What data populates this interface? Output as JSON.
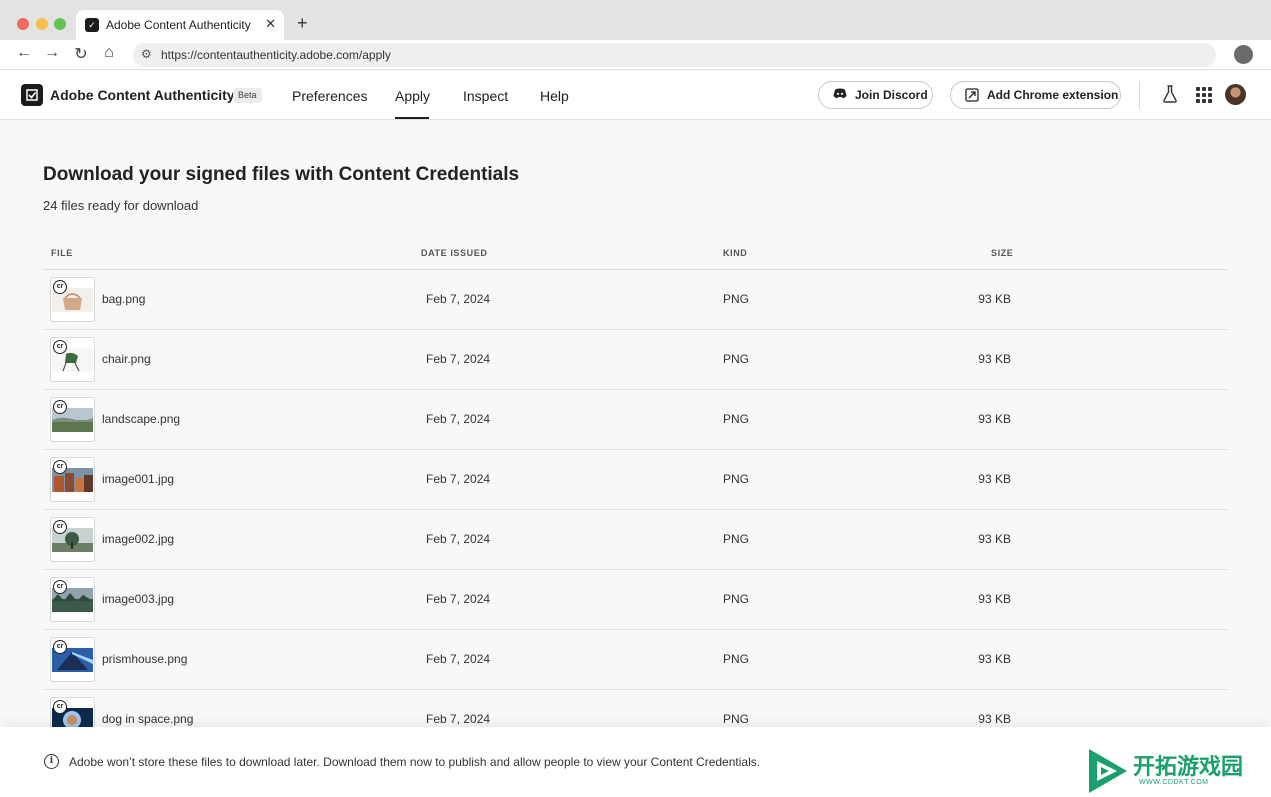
{
  "browser": {
    "tab_title": "Adobe Content Authenticity",
    "url": "https://contentauthenticity.adobe.com/apply"
  },
  "header": {
    "app_name": "Adobe Content Authenticity",
    "badge": "Beta",
    "nav": [
      "Preferences",
      "Apply",
      "Inspect",
      "Help"
    ],
    "active_nav": "Apply",
    "join_discord": "Join Discord",
    "add_extension": "Add Chrome extension"
  },
  "main": {
    "title": "Download your signed files with Content Credentials",
    "subtitle": "24 files ready for download",
    "columns": {
      "file": "FILE",
      "date": "DATE ISSUED",
      "kind": "KIND",
      "size": "SIZE"
    },
    "files": [
      {
        "name": "bag.png",
        "date": "Feb 7, 2024",
        "kind": "PNG",
        "size": "93 KB",
        "thumb": "bag"
      },
      {
        "name": "chair.png",
        "date": "Feb 7, 2024",
        "kind": "PNG",
        "size": "93 KB",
        "thumb": "chair"
      },
      {
        "name": "landscape.png",
        "date": "Feb 7, 2024",
        "kind": "PNG",
        "size": "93 KB",
        "thumb": "landscape"
      },
      {
        "name": "image001.jpg",
        "date": "Feb 7, 2024",
        "kind": "PNG",
        "size": "93 KB",
        "thumb": "city"
      },
      {
        "name": "image002.jpg",
        "date": "Feb 7, 2024",
        "kind": "PNG",
        "size": "93 KB",
        "thumb": "tree"
      },
      {
        "name": "image003.jpg",
        "date": "Feb 7, 2024",
        "kind": "PNG",
        "size": "93 KB",
        "thumb": "forest"
      },
      {
        "name": "prismhouse.png",
        "date": "Feb 7, 2024",
        "kind": "PNG",
        "size": "93 KB",
        "thumb": "prism"
      },
      {
        "name": "dog in space.png",
        "date": "Feb 7, 2024",
        "kind": "PNG",
        "size": "93 KB",
        "thumb": "space"
      }
    ]
  },
  "notice": {
    "text": "Adobe won’t store these files to download later. Download them now to publish and allow people to view your Content Credentials."
  },
  "watermark": {
    "text": "开拓游戏园",
    "sub": "WWW.CDDKT.COM"
  },
  "icons": {
    "badge": "cr"
  }
}
